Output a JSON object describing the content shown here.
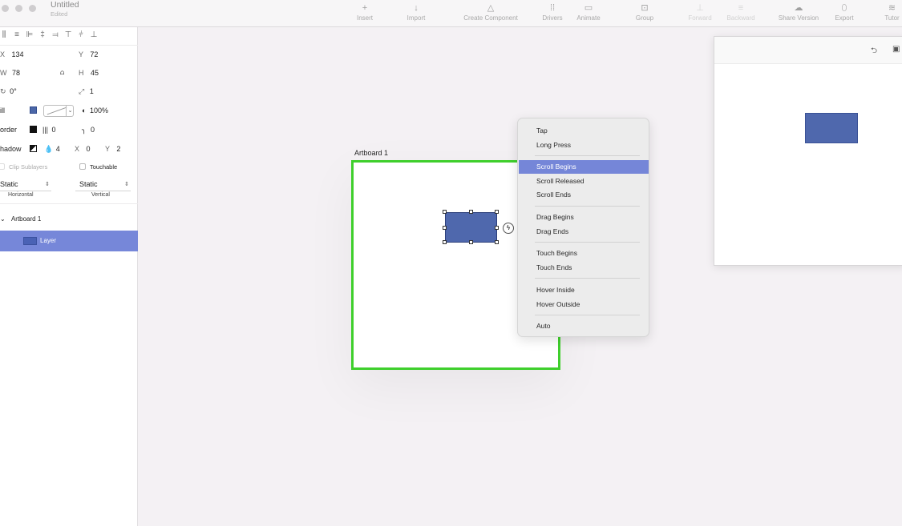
{
  "window": {
    "title": "Untitled",
    "subtitle": "Edited"
  },
  "toolbar": {
    "items": [
      {
        "label": "Insert",
        "icon": "+"
      },
      {
        "label": "Import",
        "icon": "↓"
      },
      {
        "label": "Create Component",
        "icon": "△"
      },
      {
        "label": "Drivers",
        "icon": "⁞⁞"
      },
      {
        "label": "Animate",
        "icon": "▭"
      },
      {
        "label": "Group",
        "icon": "⊡"
      },
      {
        "label": "Forward",
        "icon": "⊥"
      },
      {
        "label": "Backward",
        "icon": "≡"
      },
      {
        "label": "Share Version",
        "icon": "☁"
      },
      {
        "label": "Export",
        "icon": "⬯"
      },
      {
        "label": "Tutor",
        "icon": "≋"
      }
    ]
  },
  "inspector": {
    "x_label": "X",
    "x_value": "134",
    "y_label": "Y",
    "y_value": "72",
    "w_label": "W",
    "w_value": "78",
    "h_label": "H",
    "h_value": "45",
    "rotation_value": "0°",
    "scale_value": "1",
    "fill_label": "ill",
    "fill_color": "#4b67a8",
    "opacity_value": "100%",
    "border_label": "order",
    "border_width_value": "0",
    "corner_radius_value": "0",
    "shadow_label": "hadow",
    "shadow_blur_value": "4",
    "shadow_x_label": "X",
    "shadow_x_value": "0",
    "shadow_y_label": "Y",
    "shadow_y_value": "2",
    "clip_sublayers_label": "Clip Sublayers",
    "touchable_label": "Touchable",
    "horizontal_select": "Static",
    "horizontal_label": "Horizontal",
    "vertical_select": "Static",
    "vertical_label": "Vertical"
  },
  "layers": {
    "artboard_name": "Artboard 1",
    "layer_name": "Layer"
  },
  "canvas": {
    "artboard_label": "Artboard 1",
    "artboard_border_color": "#3fcf2c",
    "layer_color": "#4f68ad",
    "trigger_icon": "ϟ"
  },
  "context_menu": {
    "items": [
      "Tap",
      "Long Press",
      "Scroll Begins",
      "Scroll Released",
      "Scroll Ends",
      "Drag Begins",
      "Drag Ends",
      "Touch Begins",
      "Touch Ends",
      "Hover Inside",
      "Hover Outside",
      "Auto"
    ],
    "selected": "Scroll Begins",
    "highlight_color": "#7586d8"
  },
  "preview": {
    "undo_icon": "⮌",
    "device_icon": "▣"
  }
}
